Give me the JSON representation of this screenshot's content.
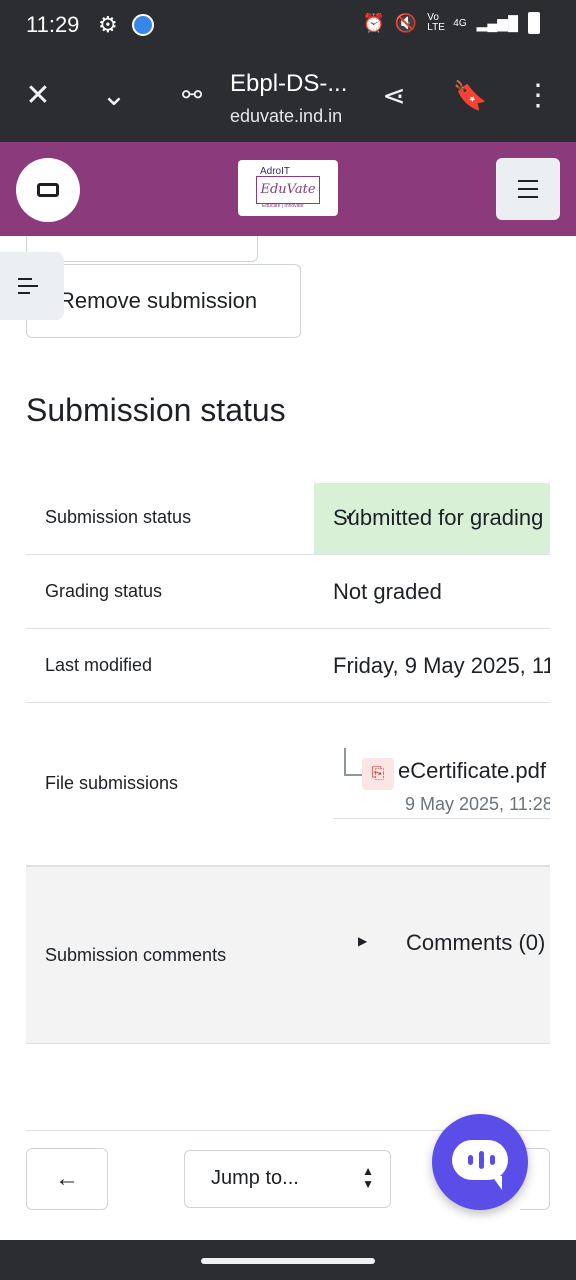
{
  "statusbar": {
    "time": "11:29",
    "icons": [
      "gear-icon",
      "app-icon",
      "alarm-icon",
      "mute-icon",
      "volte-icon",
      "signal-icon",
      "battery-icon"
    ],
    "volte": "Vo LTE",
    "network": "4G"
  },
  "browser": {
    "title": "Ebpl-DS-...",
    "url": "eduvate.ind.in",
    "icons": [
      "close-icon",
      "chevron-down-icon",
      "site-settings-icon",
      "share-icon",
      "bookmark-icon",
      "more-icon"
    ]
  },
  "site": {
    "header_color": "#8b3a7b",
    "logo": {
      "top": "AdroIT",
      "main": "EduVate",
      "sub": "Educate | Innovate"
    }
  },
  "content": {
    "remove_button": "Remove submission",
    "section_title": "Submission status",
    "rows": {
      "status": {
        "label": "Submission status",
        "value": "Submitted for grading"
      },
      "grading": {
        "label": "Grading status",
        "value": "Not graded"
      },
      "modified": {
        "label": "Last modified",
        "value": "Friday, 9 May 2025, 11"
      },
      "files": {
        "label": "File submissions",
        "file_name": "eCertificate.pdf",
        "file_date": "9 May 2025, 11:28"
      },
      "comments": {
        "label": "Submission comments",
        "link": "Comments (0)"
      }
    },
    "status_color": "#d7f0d6"
  },
  "footer": {
    "prev_arrow": "←",
    "jump_label": "Jump to...",
    "chat_color": "#5b4de8"
  }
}
